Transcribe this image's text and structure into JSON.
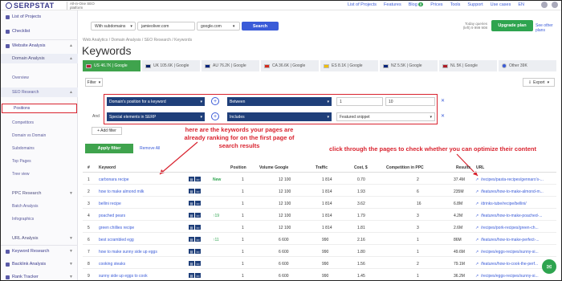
{
  "app": {
    "logo": "SERPSTAT",
    "logo_sub": "All-in-One SEO platform"
  },
  "topnav": {
    "items": [
      "List of Projects",
      "Features",
      "Blog",
      "Prices",
      "Tools",
      "Support",
      "Use cases",
      "EN"
    ],
    "blog_badge": "8"
  },
  "search": {
    "mode": "With subdomains",
    "query": "jamieoliver.com",
    "db": "google.com",
    "button": "Search"
  },
  "quota": {
    "label": "Today queries",
    "value": "(left) 9 999 908"
  },
  "upgrade": {
    "label": "Upgrade plan",
    "other": "See other plans"
  },
  "sidebar": {
    "items": [
      {
        "label": "List of Projects"
      },
      {
        "label": "Checklist"
      },
      {
        "label": "Website Analysis"
      },
      {
        "label": "Domain Analysis"
      },
      {
        "label": "Overview"
      },
      {
        "label": "SEO Research"
      },
      {
        "label": "Positions"
      },
      {
        "label": "Competitors"
      },
      {
        "label": "Domain vs Domain"
      },
      {
        "label": "Subdomains"
      },
      {
        "label": "Top Pages"
      },
      {
        "label": "Tree view"
      },
      {
        "label": "PPC Research"
      },
      {
        "label": "Batch Analysis"
      },
      {
        "label": "Infographics"
      },
      {
        "label": "URL Analysis"
      },
      {
        "label": "Keyword Research"
      },
      {
        "label": "Backlink Analysis"
      },
      {
        "label": "Rank Tracker"
      }
    ]
  },
  "breadcrumb": "Web Analytics / Domain Analysis / SEO Research / Keywords",
  "page_title": "Keywords",
  "tabs": [
    {
      "label": "US 46.7K | Google",
      "flag": "#b22234"
    },
    {
      "label": "UK 105.6K | Google",
      "flag": "#012169"
    },
    {
      "label": "AU 76.2K | Google",
      "flag": "#00247d"
    },
    {
      "label": "CA 36.6K | Google",
      "flag": "#d52b1e"
    },
    {
      "label": "ES 8.1K | Google",
      "flag": "#f1bf00"
    },
    {
      "label": "NZ 5.5K | Google",
      "flag": "#00247d"
    },
    {
      "label": "NL 5K | Google",
      "flag": "#ae1c28"
    },
    {
      "label": "Other 39K",
      "flag": "#3a5bd8"
    }
  ],
  "filter": {
    "button": "Filter",
    "export": "Export",
    "row1": {
      "field": "Domain's position for a keyword",
      "op": "Between",
      "from": "1",
      "to": "10"
    },
    "row2": {
      "field": "Special elements in SERP",
      "op": "Includes",
      "value": "Featured snippet"
    },
    "and": "And",
    "add": "+ Add filter",
    "apply": "Apply filter",
    "remove_all": "Remove All"
  },
  "annotations": {
    "left": "here are the keywords your pages are already ranking for on the first page of search results",
    "right": "click through the pages to check whether you can optimize their content"
  },
  "table": {
    "headers": [
      "#",
      "Keyword",
      "Position",
      "Volume Google",
      "Traffic",
      "Cost, $",
      "Competition in PPC",
      "Results",
      "URL"
    ],
    "rows": [
      {
        "n": "1",
        "kw": "carbonara recipe",
        "chg": "New",
        "pos": "1",
        "vol": "12 100",
        "traffic": "1 814",
        "cost": "0.70",
        "comp": "2",
        "results": "37.4M",
        "url": "/recipes/pasta-recipes/gennaro's-..."
      },
      {
        "n": "2",
        "kw": "how to make almond milk",
        "chg": "",
        "pos": "1",
        "vol": "12 100",
        "traffic": "1 814",
        "cost": "1.93",
        "comp": "6",
        "results": "235M",
        "url": "/features/how-to-make-almond-m..."
      },
      {
        "n": "3",
        "kw": "bellini recipe",
        "chg": "",
        "pos": "1",
        "vol": "12 100",
        "traffic": "1 814",
        "cost": "3.62",
        "comp": "16",
        "results": "6.8M",
        "url": "/drinks-tube/recipe/bellini/"
      },
      {
        "n": "4",
        "kw": "poached pears",
        "chg": "19",
        "pos": "1",
        "vol": "12 100",
        "traffic": "1 814",
        "cost": "1.79",
        "comp": "3",
        "results": "4.2M",
        "url": "/features/how-to-make-poached-..."
      },
      {
        "n": "5",
        "kw": "green chillies recipe",
        "chg": "",
        "pos": "1",
        "vol": "12 100",
        "traffic": "1 814",
        "cost": "1.81",
        "comp": "3",
        "results": "2.6M",
        "url": "/recipes/pork-recipes/green-ch..."
      },
      {
        "n": "6",
        "kw": "best scrambled egg",
        "chg": "11",
        "pos": "1",
        "vol": "6 600",
        "traffic": "990",
        "cost": "2.16",
        "comp": "1",
        "results": "86M",
        "url": "/features/how-to-make-perfect-..."
      },
      {
        "n": "7",
        "kw": "how to make sunny side up eggs",
        "chg": "",
        "pos": "1",
        "vol": "6 600",
        "traffic": "990",
        "cost": "1.80",
        "comp": "1",
        "results": "49.6M",
        "url": "/recipes/eggs-recipes/sunny-si..."
      },
      {
        "n": "8",
        "kw": "cooking steaks",
        "chg": "",
        "pos": "1",
        "vol": "6 600",
        "traffic": "990",
        "cost": "1.56",
        "comp": "2",
        "results": "79.1M",
        "url": "/features/how-to-cook-the-perf..."
      },
      {
        "n": "9",
        "kw": "sunny side up eggs to cook",
        "chg": "",
        "pos": "1",
        "vol": "6 600",
        "traffic": "990",
        "cost": "1.45",
        "comp": "1",
        "results": "36.2M",
        "url": "/recipes/eggs-recipes/sunny-si..."
      }
    ]
  },
  "colors": {
    "brand": "#3a3a8c",
    "accent": "#3a5bd8",
    "green": "#3fa34d",
    "red": "#d9232f",
    "navy": "#1f3f7a"
  }
}
